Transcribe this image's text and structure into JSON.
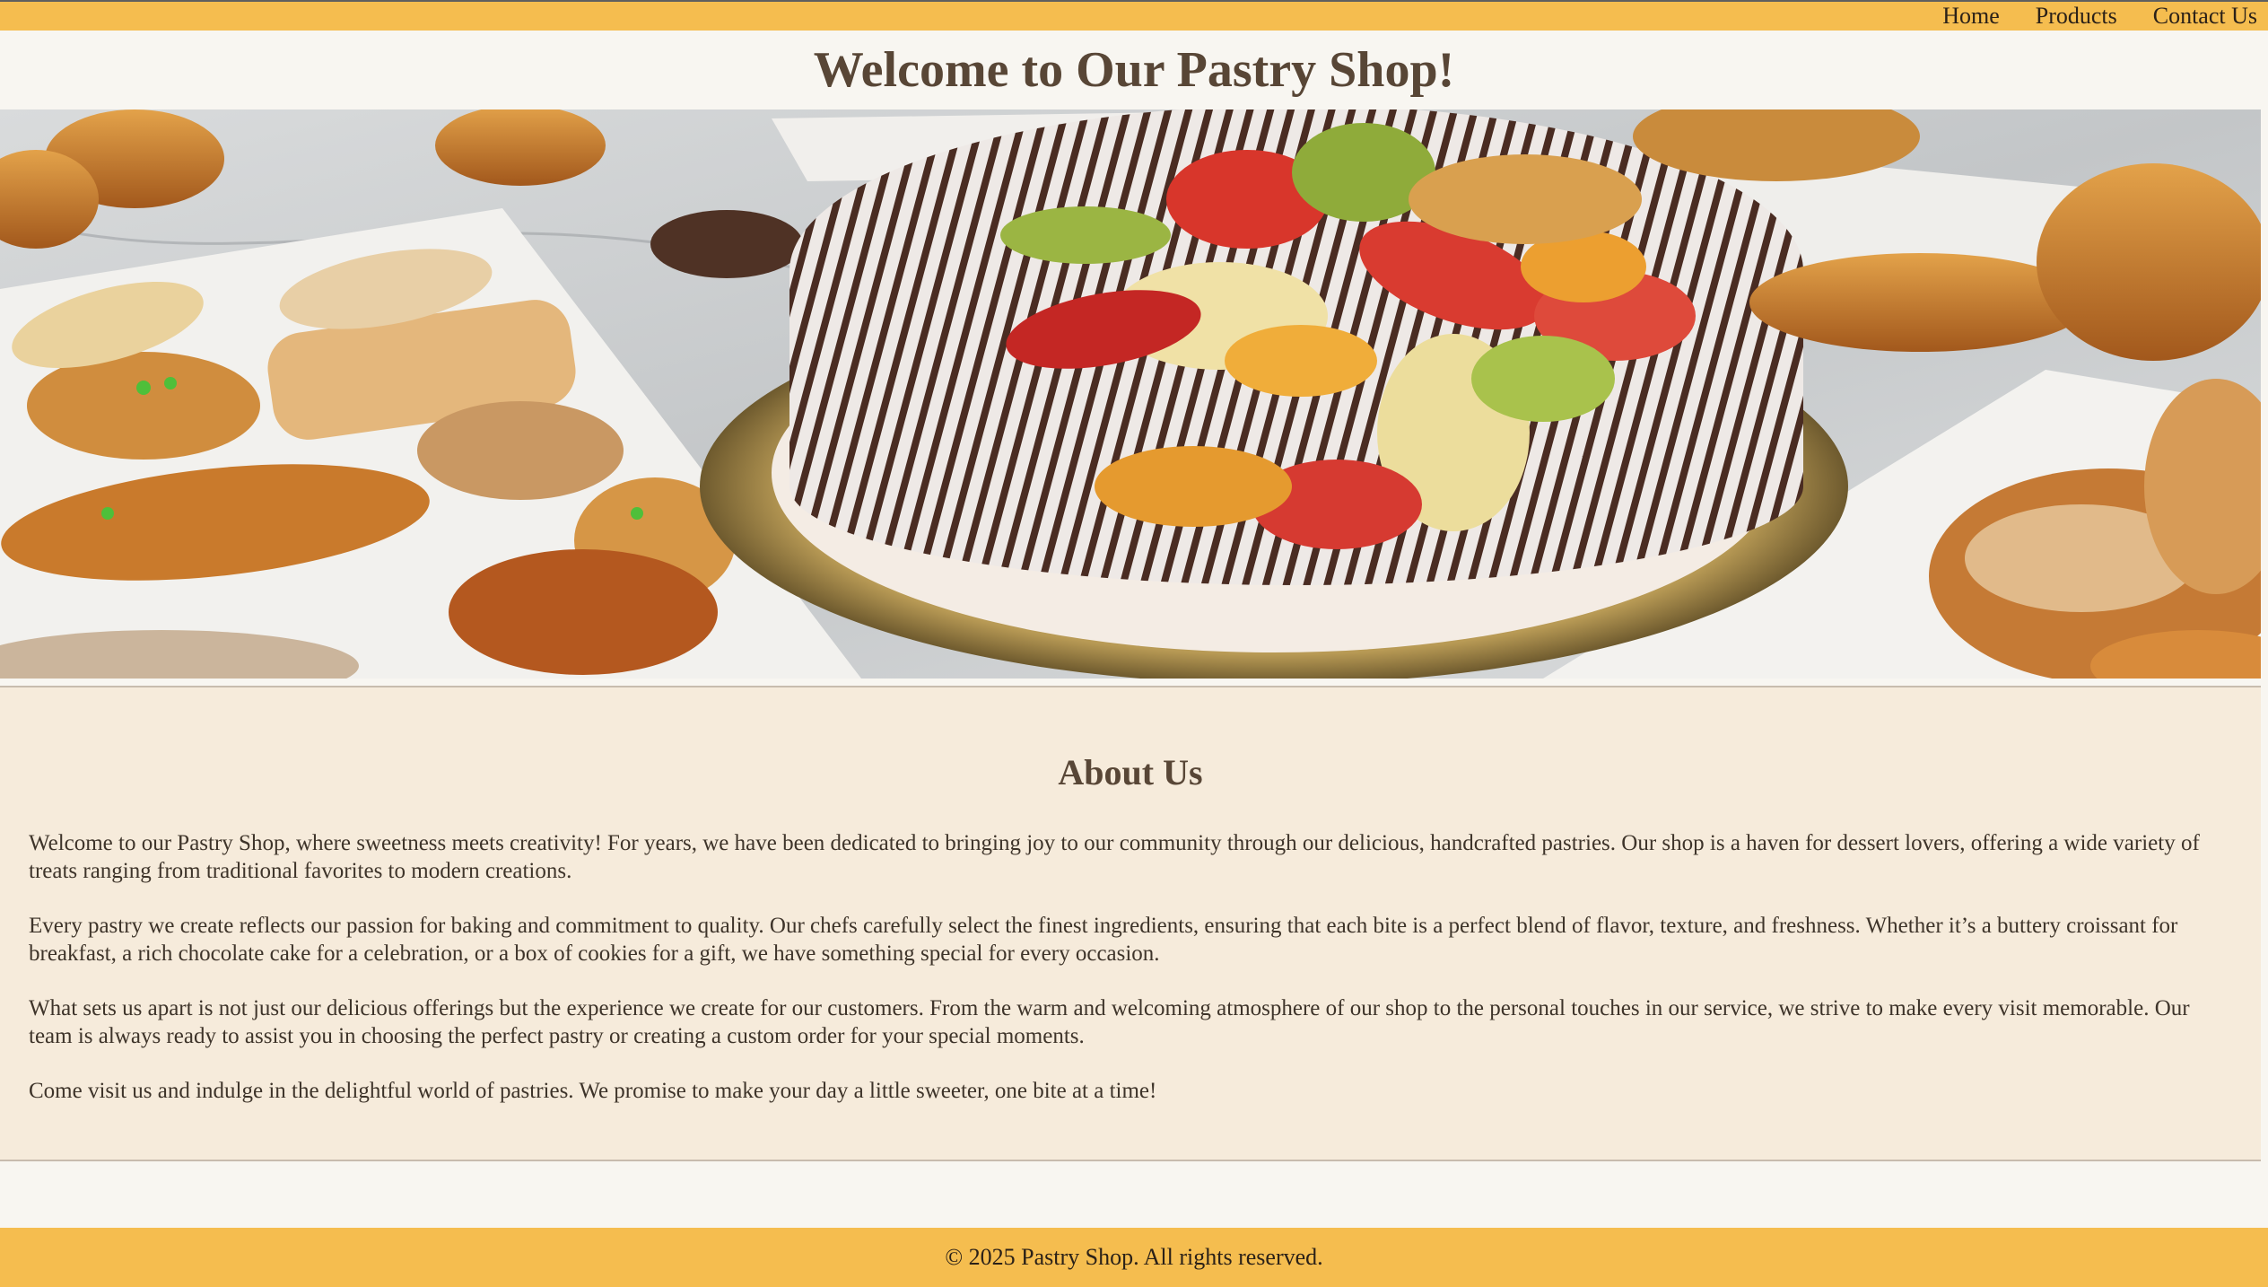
{
  "nav": {
    "links": [
      "Home",
      "Products",
      "Contact Us"
    ]
  },
  "header": {
    "title": "Welcome to Our Pastry Shop!"
  },
  "about": {
    "title": "About Us",
    "paragraphs": [
      "Welcome to our Pastry Shop, where sweetness meets creativity! For years, we have been dedicated to bringing joy to our community through our delicious, handcrafted pastries. Our shop is a haven for dessert lovers, offering a wide variety of treats ranging from traditional favorites to modern creations.",
      "Every pastry we create reflects our passion for baking and commitment to quality. Our chefs carefully select the finest ingredients, ensuring that each bite is a perfect blend of flavor, texture, and freshness. Whether it’s a buttery croissant for breakfast, a rich chocolate cake for a celebration, or a box of cookies for a gift, we have something special for every occasion.",
      "What sets us apart is not just our delicious offerings but the experience we create for our customers. From the warm and welcoming atmosphere of our shop to the personal touches in our service, we strive to make every visit memorable. Our team is always ready to assist you in choosing the perfect pastry or creating a custom order for your special moments.",
      "Come visit us and indulge in the delightful world of pastries. We promise to make your day a little sweeter, one bite at a time!"
    ]
  },
  "footer": {
    "text": "© 2025 Pastry Shop. All rights reserved."
  },
  "colors": {
    "accent": "#f5bd4f",
    "title": "#584636",
    "about_bg": "#f6ebdb",
    "page_bg": "#f8f6f1"
  }
}
